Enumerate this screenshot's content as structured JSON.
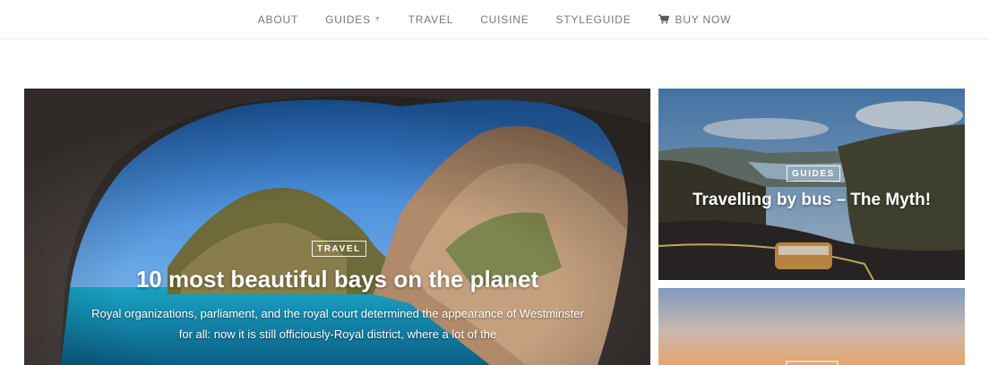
{
  "nav": {
    "items": [
      {
        "label": "ABOUT"
      },
      {
        "label": "GUIDES",
        "has_dropdown": true
      },
      {
        "label": "TRAVEL"
      },
      {
        "label": "CUISINE"
      },
      {
        "label": "STYLEGUIDE"
      },
      {
        "label": "BUY NOW",
        "icon": "cart-icon"
      }
    ]
  },
  "featured": {
    "category": "TRAVEL",
    "title": "10 most beautiful bays on the planet",
    "excerpt": "Royal organizations, parliament, and the royal court determined the appearance of Westminster for all: now it is still officiously-Royal district, where a lot of the"
  },
  "side_posts": [
    {
      "category": "GUIDES",
      "title": "Travelling by bus – The Myth!"
    }
  ],
  "colors": {
    "nav_text": "#777777",
    "sea": "#1b8fb5",
    "sky": "#3b88d6"
  }
}
